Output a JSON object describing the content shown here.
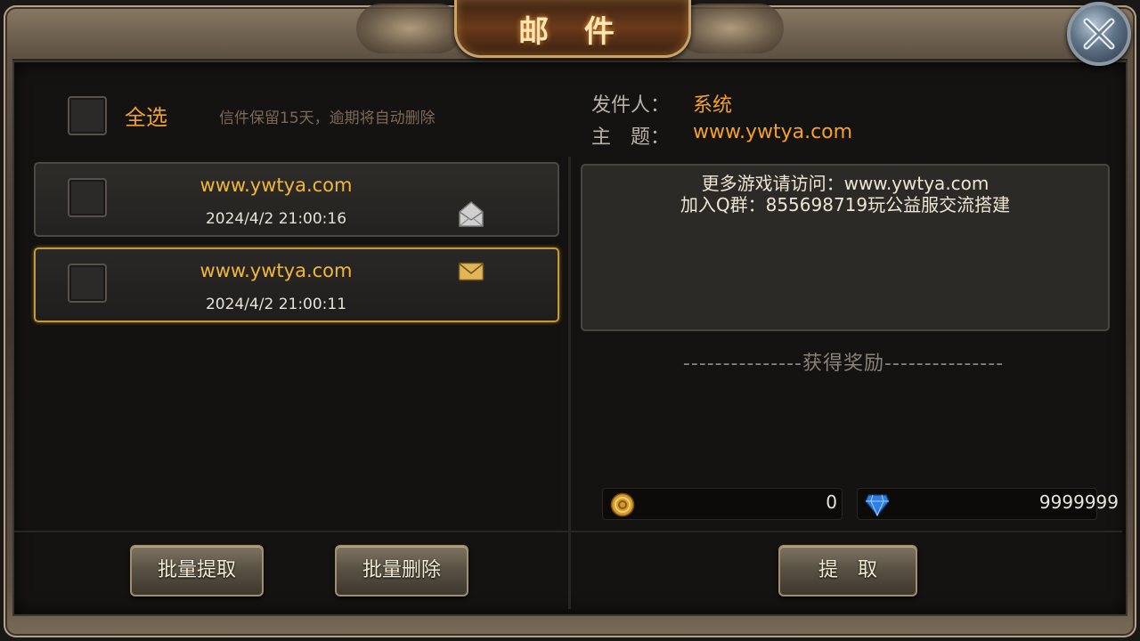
{
  "window": {
    "title": "邮 件"
  },
  "header": {
    "select_all_label": "全选",
    "retention_note": "信件保留15天，逾期将自动删除"
  },
  "mail_list": [
    {
      "title": "www.ywtya.com",
      "date": "2024/4/2 21:00:16",
      "status_icon": "envelope-open-icon",
      "selected": false
    },
    {
      "title": "www.ywtya.com",
      "date": "2024/4/2 21:00:11",
      "status_icon": "envelope-closed-icon",
      "selected": true
    }
  ],
  "detail": {
    "sender_label": "发件人：",
    "sender_value": "系统",
    "subject_label": "主　题：",
    "subject_value": "www.ywtya.com",
    "body_lines": [
      "更多游戏请访问：www.ywtya.com",
      "加入Q群：855698719玩公益服交流搭建"
    ],
    "reward_title": "---------------获得奖励---------------"
  },
  "resources": {
    "gold": {
      "icon": "gold-coin-icon",
      "value": "0"
    },
    "diamond": {
      "icon": "diamond-icon",
      "value": "9999999"
    }
  },
  "buttons": {
    "batch_claim": "批量提取",
    "batch_delete": "批量删除",
    "claim": "提　取"
  },
  "colors": {
    "accent": "#f3a12a",
    "mail_title": "#f0b73a",
    "selected_border": "#c49a3a"
  }
}
